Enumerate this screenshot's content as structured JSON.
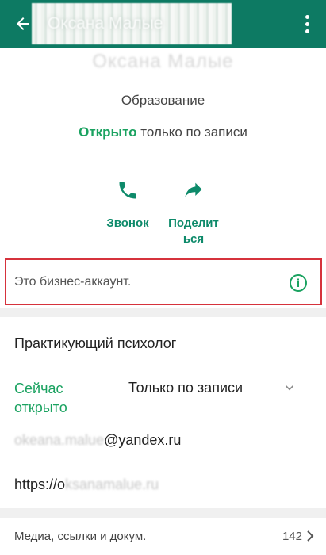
{
  "header": {
    "title": "Оксана Малые",
    "back_icon": "arrow-left-icon",
    "menu_icon": "more-vert-icon",
    "color": "#0d7a63"
  },
  "profile": {
    "name": "Оксана Малые",
    "category": "Образование",
    "status_open": "Открыто",
    "status_rest": " только по записи"
  },
  "actions": {
    "call_label": "Звонок",
    "share_label_line1": "Поделит",
    "share_label_line2": "ься"
  },
  "business_notice": {
    "text": "Это бизнес-аккаунт.",
    "icon": "info-icon"
  },
  "details": {
    "occupation": "Практикующий психолог",
    "hours_label_line1": "Сейчас",
    "hours_label_line2": "открыто",
    "hours_value": "Только по записи",
    "email_hidden": "okeana.malue",
    "email_visible": "@yandex.ru",
    "website_visible": "https://o",
    "website_hidden": "ksanamalue.ru"
  },
  "media": {
    "label": "Медиа, ссылки и докум.",
    "count": "142"
  },
  "colors": {
    "accent_green": "#1aa260",
    "header_teal": "#0d7a63",
    "highlight_red": "#d6323c"
  }
}
